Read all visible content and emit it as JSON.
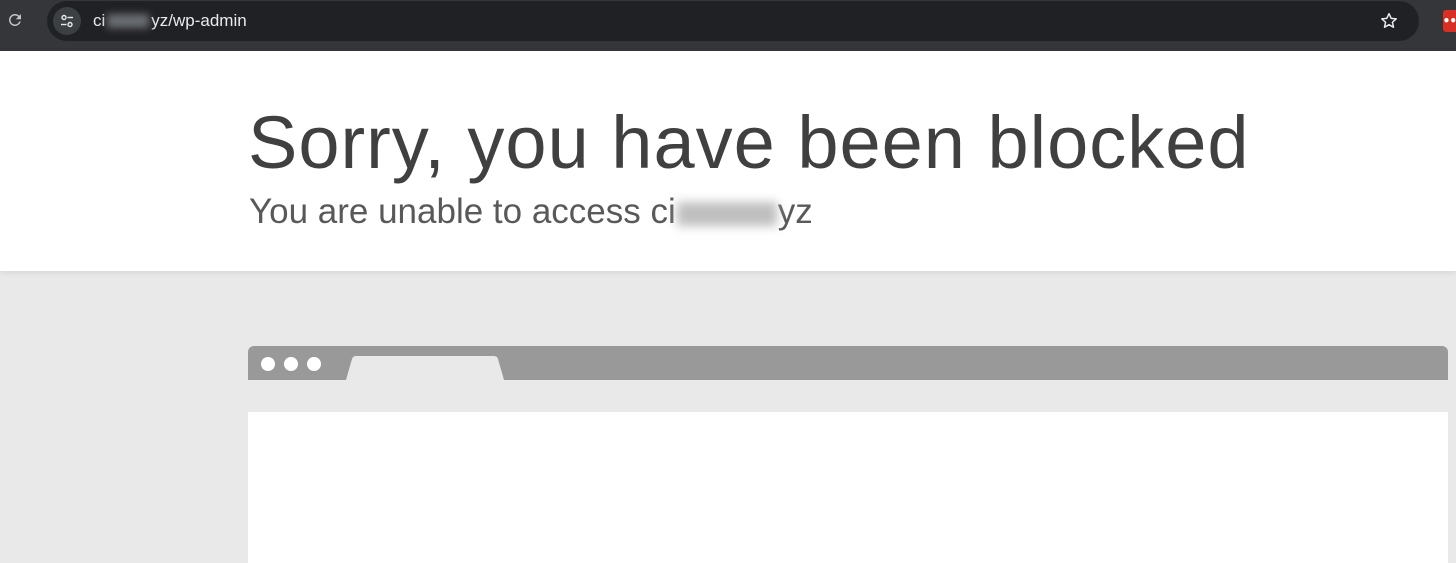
{
  "browser_chrome": {
    "url_prefix": "ci",
    "url_suffix": "yz/wp-admin",
    "icons": {
      "reload": "reload-icon",
      "site_info": "tune-icon",
      "bookmark": "star-icon",
      "extension": "extension-icon"
    },
    "extension_glyph": "•••",
    "colors": {
      "toolbar": "#35363a",
      "omnibox": "#202124",
      "extension": "#d93025"
    }
  },
  "page": {
    "title": "Sorry, you have been blocked",
    "subtitle_prefix": "You are unable to access ci",
    "subtitle_suffix": "yz",
    "colors": {
      "title": "#404040",
      "background": "#e9e9e9",
      "browser_frame": "#999999"
    }
  }
}
